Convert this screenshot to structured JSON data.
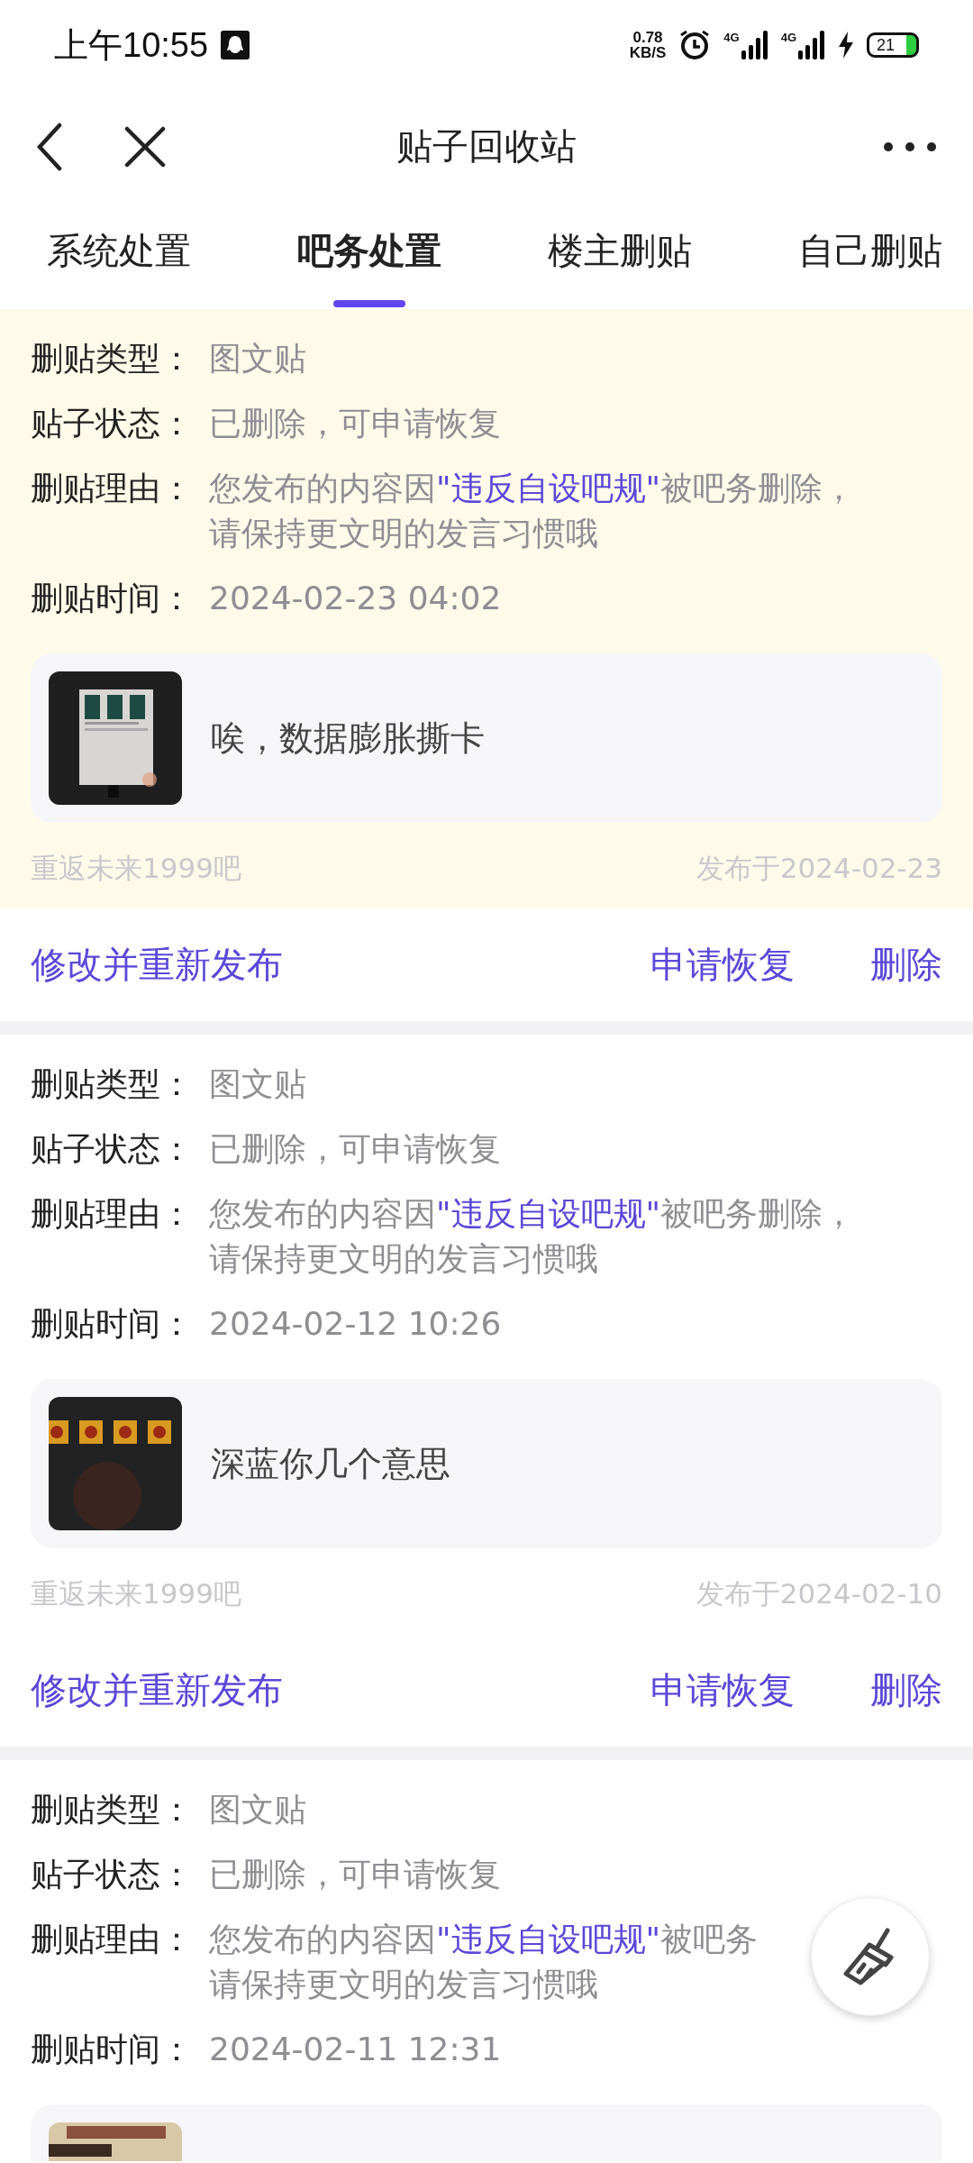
{
  "status_bar": {
    "time": "上午10:55",
    "net_speed": "0.78",
    "net_unit": "KB/S",
    "signal_1": "4G",
    "signal_2": "4G",
    "battery": "21"
  },
  "nav": {
    "title": "贴子回收站"
  },
  "tabs": [
    {
      "label": "系统处置",
      "selected": false
    },
    {
      "label": "吧务处置",
      "selected": true
    },
    {
      "label": "楼主删贴",
      "selected": false
    },
    {
      "label": "自己删贴",
      "selected": false
    }
  ],
  "posts": [
    {
      "highlighted": true,
      "fields": [
        {
          "kind": "plain",
          "label": "删贴类型：",
          "value": "图文贴"
        },
        {
          "kind": "plain",
          "label": "贴子状态：",
          "value": "已删除，可申请恢复"
        },
        {
          "kind": "reason",
          "label": "删贴理由：",
          "before": "您发布的内容因",
          "highlight": "\"违反自设吧规\"",
          "after": "被吧务删除，",
          "line2": "请保持更文明的发言习惯哦"
        },
        {
          "kind": "plain",
          "label": "删贴时间：",
          "value": "2024-02-23 04:02"
        }
      ],
      "preview": {
        "title": "唉，数据膨胀撕卡"
      },
      "footer": {
        "forum": "重返未来1999吧",
        "date": "发布于2024-02-23"
      },
      "actions": [
        "修改并重新发布",
        "申请恢复",
        "删除"
      ]
    },
    {
      "highlighted": false,
      "fields": [
        {
          "kind": "plain",
          "label": "删贴类型：",
          "value": "图文贴"
        },
        {
          "kind": "plain",
          "label": "贴子状态：",
          "value": "已删除，可申请恢复"
        },
        {
          "kind": "reason",
          "label": "删贴理由：",
          "before": "您发布的内容因",
          "highlight": "\"违反自设吧规\"",
          "after": "被吧务删除，",
          "line2": "请保持更文明的发言习惯哦"
        },
        {
          "kind": "plain",
          "label": "删贴时间：",
          "value": "2024-02-12 10:26"
        }
      ],
      "preview": {
        "title": "深蓝你几个意思"
      },
      "footer": {
        "forum": "重返未来1999吧",
        "date": "发布于2024-02-10"
      },
      "actions": [
        "修改并重新发布",
        "申请恢复",
        "删除"
      ]
    },
    {
      "highlighted": false,
      "fields": [
        {
          "kind": "plain",
          "label": "删贴类型：",
          "value": "图文贴"
        },
        {
          "kind": "plain",
          "label": "贴子状态：",
          "value": "已删除，可申请恢复"
        },
        {
          "kind": "reason",
          "label": "删贴理由：",
          "before": "您发布的内容因",
          "highlight": "\"违反自设吧规\"",
          "after": "被吧务",
          "line2": "请保持更文明的发言习惯哦"
        },
        {
          "kind": "plain",
          "label": "删贴时间：",
          "value": "2024-02-11 12:31"
        }
      ]
    }
  ]
}
